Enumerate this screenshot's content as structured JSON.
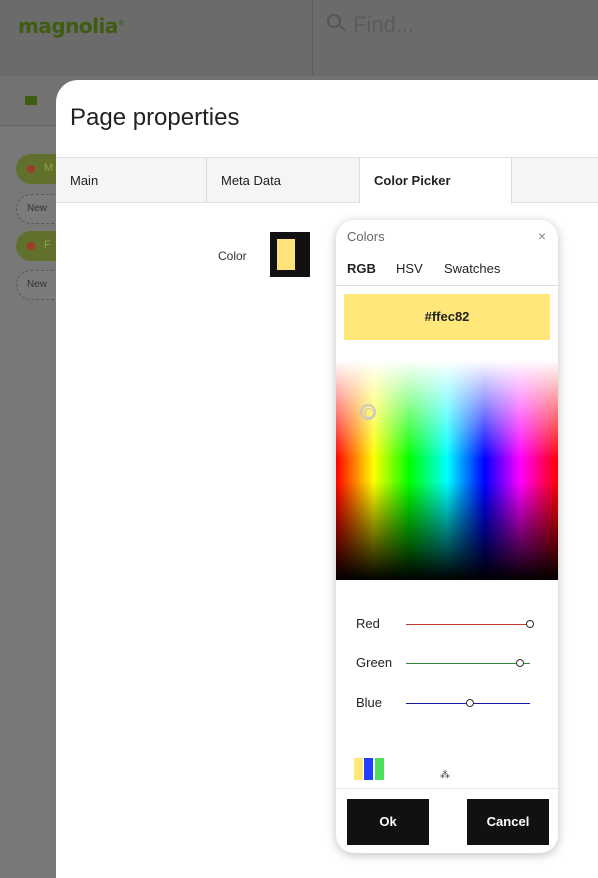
{
  "app": {
    "logo": "magnolia",
    "logo_mark": "®"
  },
  "search": {
    "placeholder": "Find..."
  },
  "sidebar": {
    "chips": [
      "New",
      "New"
    ]
  },
  "dialog": {
    "title": "Page properties",
    "tabs": [
      {
        "label": "Main"
      },
      {
        "label": "Meta Data"
      },
      {
        "label": "Color Picker"
      }
    ],
    "active_tab": "Color Picker",
    "field": {
      "label": "Color",
      "value": "#ffe27a"
    }
  },
  "color_picker": {
    "title": "Colors",
    "close": "×",
    "tabs": [
      "RGB",
      "HSV",
      "Swatches"
    ],
    "active_tab": "RGB",
    "hex": "#ffec82",
    "sliders": [
      {
        "label": "Red",
        "value": 255,
        "color": "#c0392b"
      },
      {
        "label": "Green",
        "value": 236,
        "color": "#2e8b3a"
      },
      {
        "label": "Blue",
        "value": 130,
        "color": "#1a1aa0"
      }
    ],
    "recent_colors": [
      "#ffe77a",
      "#1f3fff",
      "#4ce05a"
    ],
    "buttons": {
      "ok": "Ok",
      "cancel": "Cancel"
    }
  }
}
